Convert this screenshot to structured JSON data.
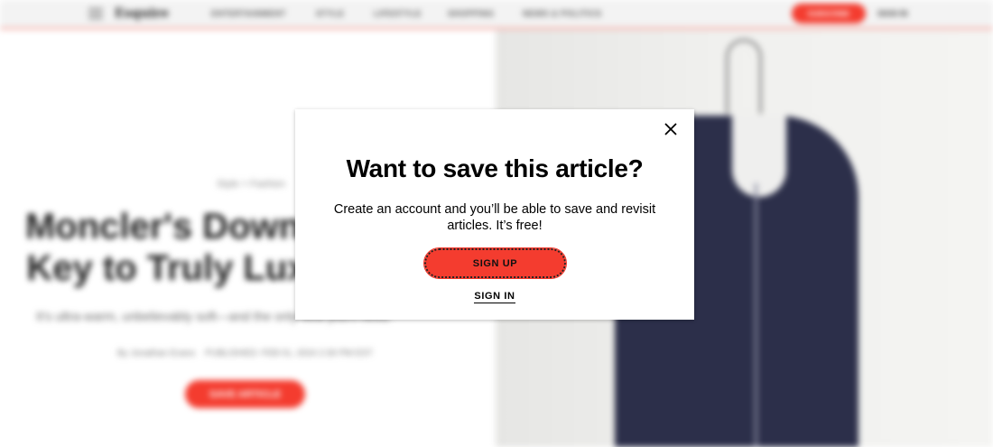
{
  "nav": {
    "logo": "Esquire",
    "links": [
      "ENTERTAINMENT",
      "STYLE",
      "LIFESTYLE",
      "SHOPPING",
      "NEWS & POLITICS"
    ],
    "subscribe_label": "SUBSCRIBE",
    "signin_label": "SIGN IN"
  },
  "article": {
    "breadcrumb": "Style > Fashion",
    "headline": "Moncler's Down Vest Is the Key to Truly Luxe Layering",
    "dek": "It's ultra-warm, unbelievably soft—and the only vest you'll need.",
    "byline": "By Jonathan Evans",
    "published": "PUBLISHED: FEB 01, 2024 2:30 PM EST",
    "save_label": "SAVE ARTICLE"
  },
  "modal": {
    "title": "Want to save this article?",
    "body": "Create an account and you’ll be able to save and revisit articles. It’s free!",
    "signup_label": "SIGN UP",
    "signin_label": "SIGN IN",
    "close_icon": "close-icon"
  },
  "colors": {
    "accent": "#f43c2f",
    "vest": "#2c2f4a"
  }
}
